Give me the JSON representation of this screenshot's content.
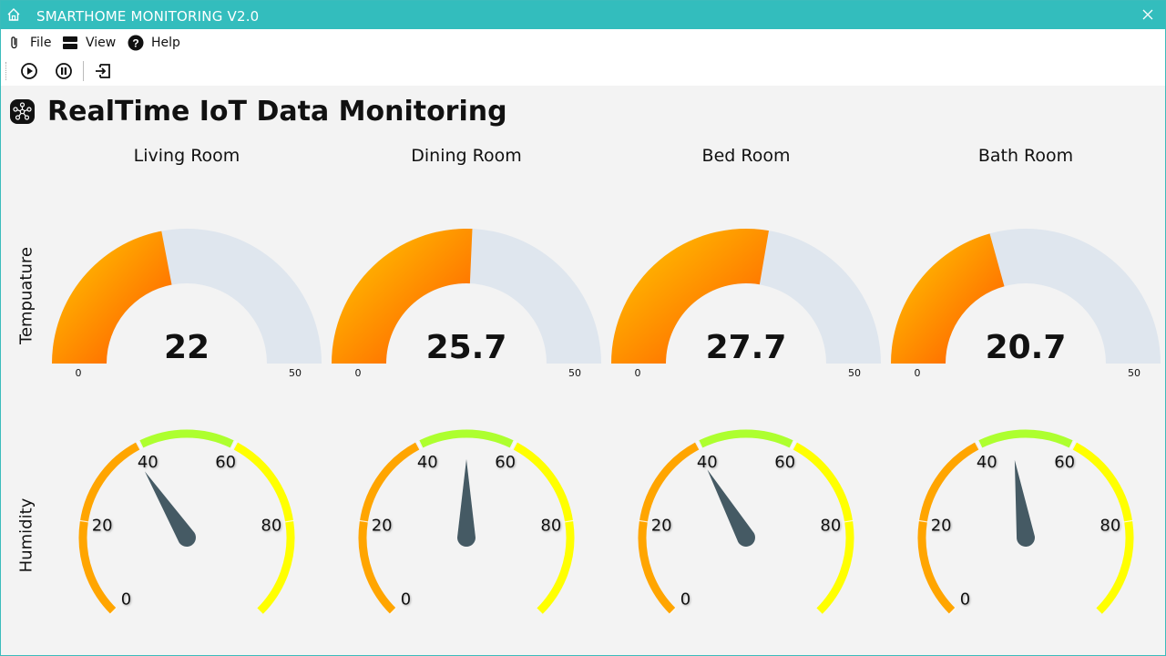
{
  "window": {
    "title": "SMARTHOME MONITORING V2.0"
  },
  "menu": {
    "items": [
      {
        "label": "File",
        "icon": "paperclip-icon"
      },
      {
        "label": "View",
        "icon": "server-icon"
      },
      {
        "label": "Help",
        "icon": "help-icon"
      }
    ]
  },
  "toolbar": {
    "buttons": [
      "play-icon",
      "pause-icon",
      "exit-icon"
    ]
  },
  "header": {
    "title": "RealTime IoT Data Monitoring",
    "icon": "network-logo-icon"
  },
  "rows": {
    "temperature": "Tempuature",
    "humidity": "Humidity"
  },
  "rooms": [
    {
      "name": "Living Room",
      "temperature": "22",
      "temp_value": 22,
      "humidity": 38
    },
    {
      "name": "Dining Room",
      "temperature": "25.7",
      "temp_value": 25.7,
      "humidity": 50
    },
    {
      "name": "Bed Room",
      "temperature": "27.7",
      "temp_value": 27.7,
      "humidity": 39
    },
    {
      "name": "Bath Room",
      "temperature": "20.7",
      "temp_value": 20.7,
      "humidity": 47
    }
  ],
  "temp_gauge": {
    "min": "0",
    "max": "50",
    "min_value": 0,
    "max_value": 50
  },
  "humidity_gauge": {
    "min_value": 0,
    "max_value": 100,
    "ticks": [
      "0",
      "20",
      "40",
      "60",
      "80"
    ],
    "bands": [
      {
        "from": 0,
        "to": 40,
        "color": "#ffa500"
      },
      {
        "from": 40,
        "to": 60,
        "color": "#adff2f"
      },
      {
        "from": 60,
        "to": 100,
        "color": "#ffff00"
      }
    ]
  },
  "colors": {
    "titlebar": "#33bdbd",
    "temp_fill_start": "#ffcc00",
    "temp_fill_end": "#ff5500",
    "temp_track": "#dfe6ee",
    "needle": "#455a64"
  }
}
